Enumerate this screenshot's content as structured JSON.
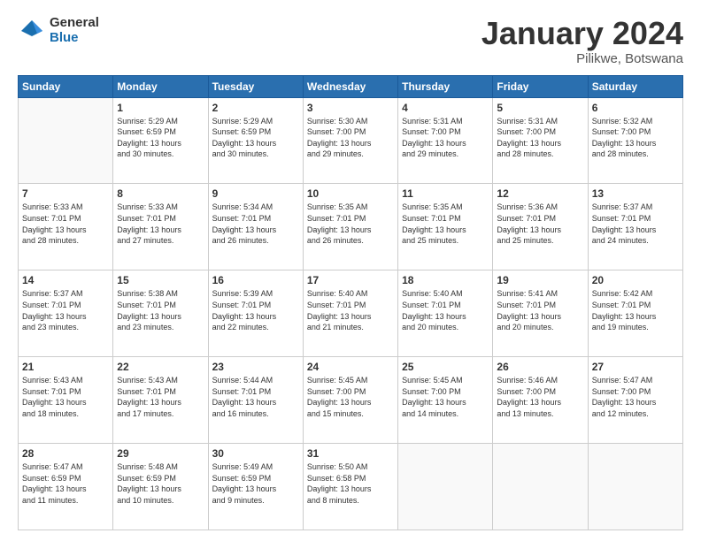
{
  "logo": {
    "general": "General",
    "blue": "Blue"
  },
  "header": {
    "month": "January 2024",
    "location": "Pilikwe, Botswana"
  },
  "weekdays": [
    "Sunday",
    "Monday",
    "Tuesday",
    "Wednesday",
    "Thursday",
    "Friday",
    "Saturday"
  ],
  "weeks": [
    [
      {
        "day": "",
        "info": ""
      },
      {
        "day": "1",
        "info": "Sunrise: 5:29 AM\nSunset: 6:59 PM\nDaylight: 13 hours\nand 30 minutes."
      },
      {
        "day": "2",
        "info": "Sunrise: 5:29 AM\nSunset: 6:59 PM\nDaylight: 13 hours\nand 30 minutes."
      },
      {
        "day": "3",
        "info": "Sunrise: 5:30 AM\nSunset: 7:00 PM\nDaylight: 13 hours\nand 29 minutes."
      },
      {
        "day": "4",
        "info": "Sunrise: 5:31 AM\nSunset: 7:00 PM\nDaylight: 13 hours\nand 29 minutes."
      },
      {
        "day": "5",
        "info": "Sunrise: 5:31 AM\nSunset: 7:00 PM\nDaylight: 13 hours\nand 28 minutes."
      },
      {
        "day": "6",
        "info": "Sunrise: 5:32 AM\nSunset: 7:00 PM\nDaylight: 13 hours\nand 28 minutes."
      }
    ],
    [
      {
        "day": "7",
        "info": "Sunrise: 5:33 AM\nSunset: 7:01 PM\nDaylight: 13 hours\nand 28 minutes."
      },
      {
        "day": "8",
        "info": "Sunrise: 5:33 AM\nSunset: 7:01 PM\nDaylight: 13 hours\nand 27 minutes."
      },
      {
        "day": "9",
        "info": "Sunrise: 5:34 AM\nSunset: 7:01 PM\nDaylight: 13 hours\nand 26 minutes."
      },
      {
        "day": "10",
        "info": "Sunrise: 5:35 AM\nSunset: 7:01 PM\nDaylight: 13 hours\nand 26 minutes."
      },
      {
        "day": "11",
        "info": "Sunrise: 5:35 AM\nSunset: 7:01 PM\nDaylight: 13 hours\nand 25 minutes."
      },
      {
        "day": "12",
        "info": "Sunrise: 5:36 AM\nSunset: 7:01 PM\nDaylight: 13 hours\nand 25 minutes."
      },
      {
        "day": "13",
        "info": "Sunrise: 5:37 AM\nSunset: 7:01 PM\nDaylight: 13 hours\nand 24 minutes."
      }
    ],
    [
      {
        "day": "14",
        "info": "Sunrise: 5:37 AM\nSunset: 7:01 PM\nDaylight: 13 hours\nand 23 minutes."
      },
      {
        "day": "15",
        "info": "Sunrise: 5:38 AM\nSunset: 7:01 PM\nDaylight: 13 hours\nand 23 minutes."
      },
      {
        "day": "16",
        "info": "Sunrise: 5:39 AM\nSunset: 7:01 PM\nDaylight: 13 hours\nand 22 minutes."
      },
      {
        "day": "17",
        "info": "Sunrise: 5:40 AM\nSunset: 7:01 PM\nDaylight: 13 hours\nand 21 minutes."
      },
      {
        "day": "18",
        "info": "Sunrise: 5:40 AM\nSunset: 7:01 PM\nDaylight: 13 hours\nand 20 minutes."
      },
      {
        "day": "19",
        "info": "Sunrise: 5:41 AM\nSunset: 7:01 PM\nDaylight: 13 hours\nand 20 minutes."
      },
      {
        "day": "20",
        "info": "Sunrise: 5:42 AM\nSunset: 7:01 PM\nDaylight: 13 hours\nand 19 minutes."
      }
    ],
    [
      {
        "day": "21",
        "info": "Sunrise: 5:43 AM\nSunset: 7:01 PM\nDaylight: 13 hours\nand 18 minutes."
      },
      {
        "day": "22",
        "info": "Sunrise: 5:43 AM\nSunset: 7:01 PM\nDaylight: 13 hours\nand 17 minutes."
      },
      {
        "day": "23",
        "info": "Sunrise: 5:44 AM\nSunset: 7:01 PM\nDaylight: 13 hours\nand 16 minutes."
      },
      {
        "day": "24",
        "info": "Sunrise: 5:45 AM\nSunset: 7:00 PM\nDaylight: 13 hours\nand 15 minutes."
      },
      {
        "day": "25",
        "info": "Sunrise: 5:45 AM\nSunset: 7:00 PM\nDaylight: 13 hours\nand 14 minutes."
      },
      {
        "day": "26",
        "info": "Sunrise: 5:46 AM\nSunset: 7:00 PM\nDaylight: 13 hours\nand 13 minutes."
      },
      {
        "day": "27",
        "info": "Sunrise: 5:47 AM\nSunset: 7:00 PM\nDaylight: 13 hours\nand 12 minutes."
      }
    ],
    [
      {
        "day": "28",
        "info": "Sunrise: 5:47 AM\nSunset: 6:59 PM\nDaylight: 13 hours\nand 11 minutes."
      },
      {
        "day": "29",
        "info": "Sunrise: 5:48 AM\nSunset: 6:59 PM\nDaylight: 13 hours\nand 10 minutes."
      },
      {
        "day": "30",
        "info": "Sunrise: 5:49 AM\nSunset: 6:59 PM\nDaylight: 13 hours\nand 9 minutes."
      },
      {
        "day": "31",
        "info": "Sunrise: 5:50 AM\nSunset: 6:58 PM\nDaylight: 13 hours\nand 8 minutes."
      },
      {
        "day": "",
        "info": ""
      },
      {
        "day": "",
        "info": ""
      },
      {
        "day": "",
        "info": ""
      }
    ]
  ]
}
